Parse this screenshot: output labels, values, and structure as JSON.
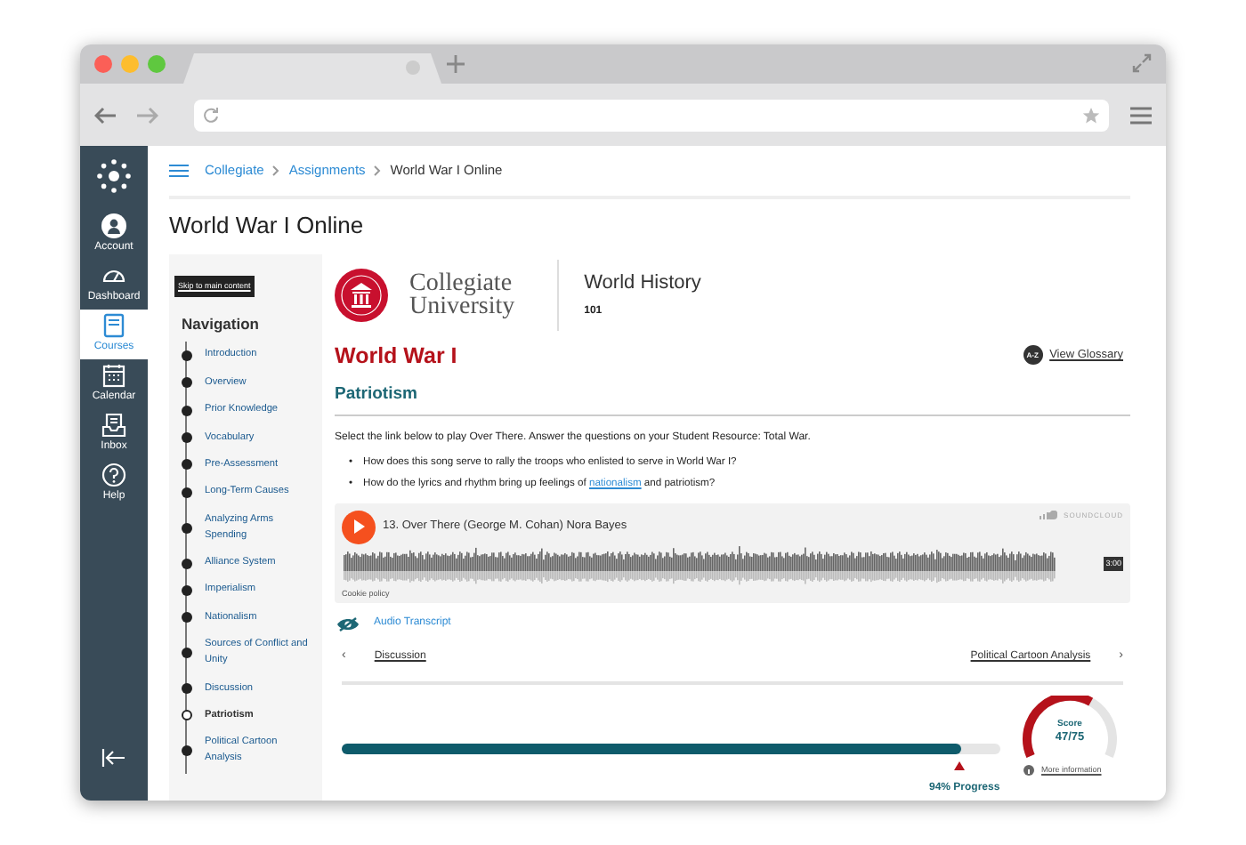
{
  "global_nav": [
    {
      "kind": "account",
      "label": "Account",
      "selected": false
    },
    {
      "kind": "dashboard",
      "label": "Dashboard",
      "selected": false
    },
    {
      "kind": "courses",
      "label": "Courses",
      "selected": true
    },
    {
      "kind": "calendar",
      "label": "Calendar",
      "selected": false
    },
    {
      "kind": "inbox",
      "label": "Inbox",
      "selected": false
    },
    {
      "kind": "help",
      "label": "Help",
      "selected": false
    }
  ],
  "breadcrumb": [
    {
      "label": "Collegiate",
      "kind": "link"
    },
    {
      "label": "Assignments",
      "kind": "link"
    },
    {
      "label": "World War I Online",
      "kind": "current"
    }
  ],
  "page_title": "World War I Online",
  "skip_link": "Skip to main content",
  "course_nav": {
    "heading": "Navigation",
    "items": [
      {
        "label": "Introduction",
        "selected": false
      },
      {
        "label": "Overview",
        "selected": false
      },
      {
        "label": "Prior Knowledge",
        "selected": false
      },
      {
        "label": "Vocabulary",
        "selected": false
      },
      {
        "label": "Pre-Assessment",
        "selected": false
      },
      {
        "label": "Long-Term Causes",
        "selected": false
      },
      {
        "label": "Analyzing Arms Spending",
        "selected": false
      },
      {
        "label": "Alliance System",
        "selected": false
      },
      {
        "label": "Imperialism",
        "selected": false
      },
      {
        "label": "Nationalism",
        "selected": false
      },
      {
        "label": "Sources of Conflict and Unity",
        "selected": false
      },
      {
        "label": "Discussion",
        "selected": false
      },
      {
        "label": "Patriotism",
        "selected": true
      },
      {
        "label": "Political Cartoon Analysis",
        "selected": false
      }
    ]
  },
  "banner": {
    "school": [
      "Collegiate",
      "University"
    ],
    "course": "World History",
    "code": "101"
  },
  "module": {
    "title": "World War I",
    "glossary_badge": "A-Z",
    "glossary_link": "View Glossary",
    "section": "Patriotism",
    "intro": "Select the link below to play Over There. Answer the questions on your Student Resource: Total War.",
    "questions": [
      {
        "bullet": "•",
        "before": "How does this song serve to rally the troops who enlisted to serve in World War I?"
      },
      {
        "bullet": "•",
        "before": "How do the lyrics and rhythm bring up feelings of ",
        "link": "nationalism",
        "after": " and patriotism?"
      }
    ]
  },
  "player": {
    "track": "13. Over There (George M. Cohan) Nora Bayes",
    "brand": "SOUNDCLOUD",
    "duration": "3:00",
    "cookie": "Cookie policy"
  },
  "transcript": "Audio Transcript",
  "pager": {
    "prev_arrow": "‹",
    "prev": "Discussion",
    "next": "Political Cartoon Analysis",
    "next_arrow": "›"
  },
  "progress": {
    "level": 0.94,
    "label": "94% Progress"
  },
  "score": {
    "label": "Score",
    "value": "47/75",
    "level": 0.63,
    "info": "More information"
  }
}
